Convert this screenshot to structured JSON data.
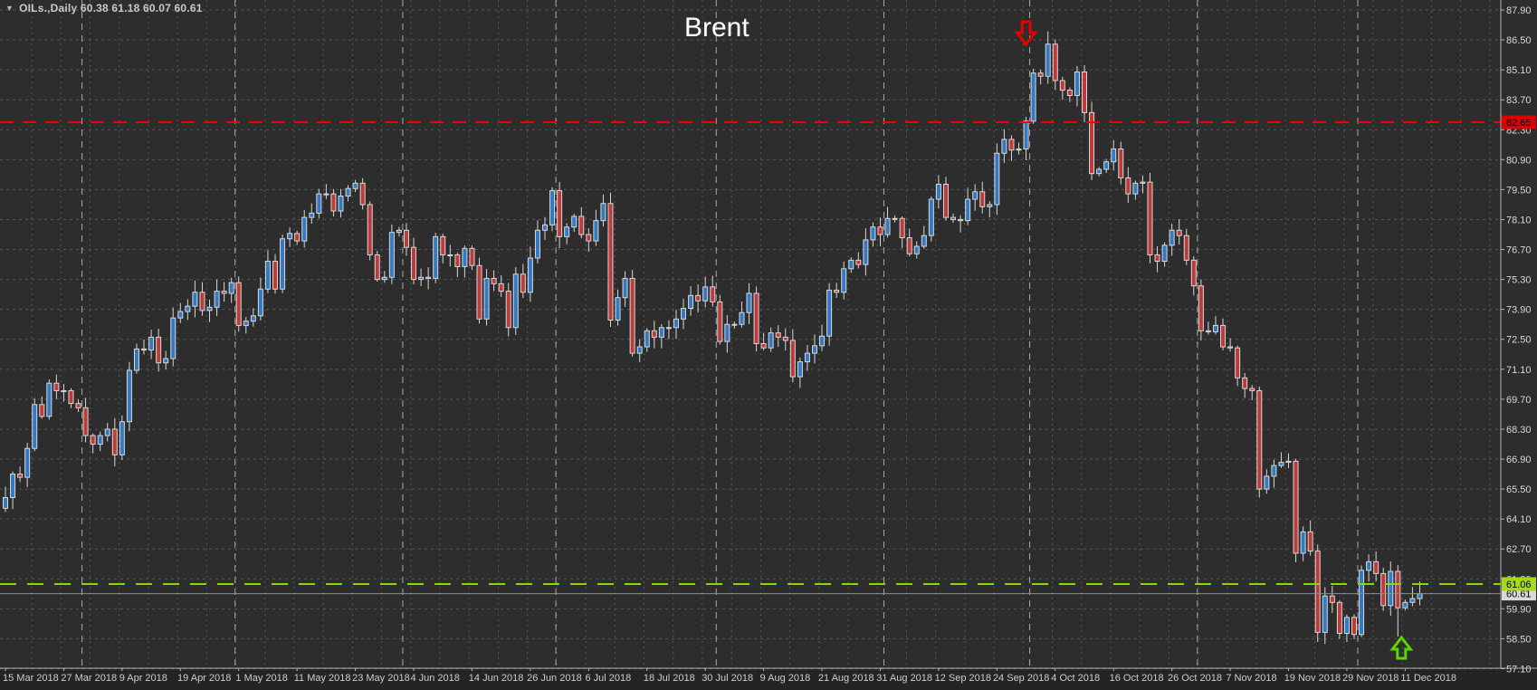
{
  "header": {
    "dropdown_icon": "▼",
    "symbol_line": "OILs.,Daily  60.38 61.18 60.07 60.61"
  },
  "title": "Brent",
  "colors": {
    "background": "#2d2d2d",
    "time_strip": "#242424",
    "grid": "#565656",
    "month_separator": "#a8a8a8",
    "axis_line": "#b5b5b5",
    "axis_text": "#d8d8d8",
    "date_text": "#cdcdcd",
    "candle_up": "#3479c3",
    "candle_down": "#bc3b3b",
    "candle_wick": "#d8d8d8",
    "resistance_line": "#f20000",
    "resistance_tag": "#e00000",
    "support_line": "#7fdc00",
    "support_tag": "#a8d917",
    "current_price_line": "#8f8f8f",
    "current_price_tag": "#d9d9d9",
    "tag_text": "#000000",
    "arrow_down": "#e60000",
    "arrow_up": "#58d800",
    "title_text": "#ffffff"
  },
  "chart_data": {
    "type": "candlestick",
    "symbol": "OILs.",
    "timeframe": "Daily",
    "title": "Brent",
    "last_ohlc": {
      "open": 60.38,
      "high": 61.18,
      "low": 60.07,
      "close": 60.61
    },
    "y_axis": {
      "min": 57.1,
      "max": 87.9,
      "step": 1.4,
      "ticks": [
        "87.90",
        "86.50",
        "85.10",
        "83.70",
        "82.30",
        "80.90",
        "79.50",
        "78.10",
        "76.70",
        "75.30",
        "73.90",
        "72.50",
        "71.10",
        "69.70",
        "68.30",
        "66.90",
        "65.50",
        "64.10",
        "62.70",
        "61.30",
        "59.90",
        "58.50",
        "57.10"
      ]
    },
    "x_axis": {
      "labels": [
        "15 Mar 2018",
        "27 Mar 2018",
        "9 Apr 2018",
        "19 Apr 2018",
        "1 May 2018",
        "11 May 2018",
        "23 May 2018",
        "4 Jun 2018",
        "14 Jun 2018",
        "26 Jun 2018",
        "6 Jul 2018",
        "18 Jul 2018",
        "30 Jul 2018",
        "9 Aug 2018",
        "21 Aug 2018",
        "31 Aug 2018",
        "12 Sep 2018",
        "24 Sep 2018",
        "4 Oct 2018",
        "16 Oct 2018",
        "26 Oct 2018",
        "7 Nov 2018",
        "19 Nov 2018",
        "29 Nov 2018",
        "11 Dec 2018"
      ],
      "candles_per_label": 8
    },
    "levels": [
      {
        "name": "resistance",
        "price": 82.65,
        "label": "82.65",
        "style": "dashed"
      },
      {
        "name": "support",
        "price": 61.06,
        "label": "61.06",
        "style": "dashed"
      },
      {
        "name": "current",
        "price": 60.61,
        "label": "60.61",
        "style": "solid"
      }
    ],
    "annotations": [
      {
        "type": "arrow-down",
        "candle_index": 140
      },
      {
        "type": "arrow-up",
        "candle_index": 191
      }
    ],
    "month_start_indices": [
      11,
      32,
      55,
      76,
      98,
      121,
      141,
      164,
      186
    ],
    "first_open": 64.6,
    "closes": [
      65.1,
      66.2,
      66.05,
      67.4,
      69.45,
      68.9,
      70.45,
      70.1,
      70.1,
      69.5,
      69.3,
      68.0,
      67.6,
      68.0,
      68.3,
      67.1,
      68.65,
      71.05,
      72.05,
      72.0,
      72.6,
      71.4,
      71.6,
      73.5,
      73.8,
      74.05,
      74.7,
      73.85,
      74.0,
      74.75,
      74.65,
      75.15,
      73.15,
      73.35,
      73.6,
      74.85,
      76.15,
      74.85,
      77.2,
      77.45,
      77.1,
      78.2,
      78.4,
      79.3,
      79.3,
      78.5,
      79.2,
      79.55,
      79.8,
      78.8,
      76.45,
      75.3,
      75.4,
      77.5,
      77.6,
      76.8,
      75.3,
      75.4,
      75.35,
      77.3,
      76.45,
      76.45,
      75.9,
      76.75,
      75.95,
      73.45,
      75.35,
      75.1,
      74.75,
      73.05,
      75.55,
      74.7,
      76.3,
      77.6,
      77.85,
      79.45,
      77.3,
      77.75,
      78.25,
      77.4,
      77.1,
      78.05,
      78.85,
      73.4,
      74.45,
      75.35,
      71.85,
      72.15,
      72.9,
      72.6,
      73.05,
      73.05,
      73.45,
      73.95,
      74.55,
      74.3,
      74.95,
      74.25,
      72.4,
      73.2,
      73.2,
      73.75,
      74.65,
      72.3,
      72.1,
      72.8,
      72.6,
      72.45,
      70.75,
      71.45,
      71.85,
      72.2,
      72.65,
      74.8,
      74.7,
      75.8,
      76.2,
      76.0,
      77.15,
      77.75,
      77.4,
      78.15,
      78.15,
      77.25,
      76.5,
      76.85,
      77.35,
      79.05,
      79.75,
      78.2,
      78.1,
      78.05,
      79.05,
      79.4,
      78.7,
      78.8,
      81.2,
      81.85,
      81.35,
      81.4,
      82.7,
      84.95,
      84.8,
      86.3,
      84.6,
      84.15,
      83.9,
      85.0,
      83.1,
      80.25,
      80.45,
      80.8,
      81.4,
      80.05,
      79.3,
      79.8,
      79.85,
      76.45,
      76.15,
      76.9,
      77.6,
      77.35,
      76.2,
      75.0,
      72.9,
      72.85,
      73.15,
      72.15,
      72.1,
      70.7,
      70.2,
      70.1,
      65.5,
      66.1,
      66.6,
      66.75,
      66.8,
      62.5,
      63.5,
      62.6,
      58.8,
      60.5,
      60.2,
      58.75,
      59.5,
      58.7,
      61.7,
      62.1,
      61.55,
      60.05,
      61.65,
      59.95,
      60.2,
      60.38,
      60.61
    ],
    "wick_overrides": {
      "143": {
        "high": 86.9
      },
      "172": {
        "low": 65.1
      },
      "180": {
        "low": 58.35
      },
      "191": {
        "low": 58.6
      }
    }
  }
}
